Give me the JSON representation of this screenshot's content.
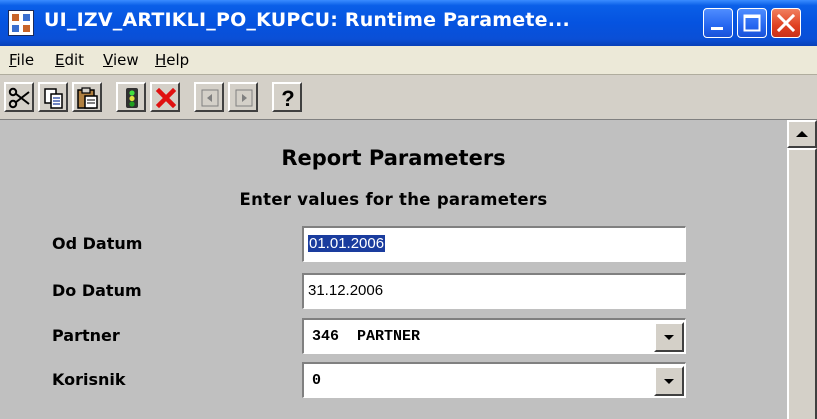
{
  "window": {
    "title": "UI_IZV_ARTIKLI_PO_KUPCU: Runtime Paramete...",
    "controls": [
      "minimize-icon",
      "maximize-icon",
      "close-icon"
    ]
  },
  "menu": {
    "items": [
      {
        "label": "File"
      },
      {
        "label": "Edit"
      },
      {
        "label": "View"
      },
      {
        "label": "Help"
      }
    ]
  },
  "toolbar": {
    "buttons": [
      "cut-icon",
      "copy-icon",
      "paste-icon",
      "run-icon",
      "cancel-icon",
      "previous-icon",
      "next-icon",
      "help-icon"
    ],
    "help_label": "?"
  },
  "form": {
    "heading": "Report Parameters",
    "subheading": "Enter values for the parameters",
    "fields": [
      {
        "label": "Od Datum",
        "value": "01.01.2006"
      },
      {
        "label": "Do Datum",
        "value": "31.12.2006"
      },
      {
        "label": "Partner",
        "value": "346  PARTNER"
      },
      {
        "label": "Korisnik",
        "value": "0"
      }
    ]
  },
  "colors": {
    "titlebar": "#0553e0",
    "close_button": "#e04020",
    "selection": "#1a3c9e",
    "form_background": "#c0c0c0"
  }
}
